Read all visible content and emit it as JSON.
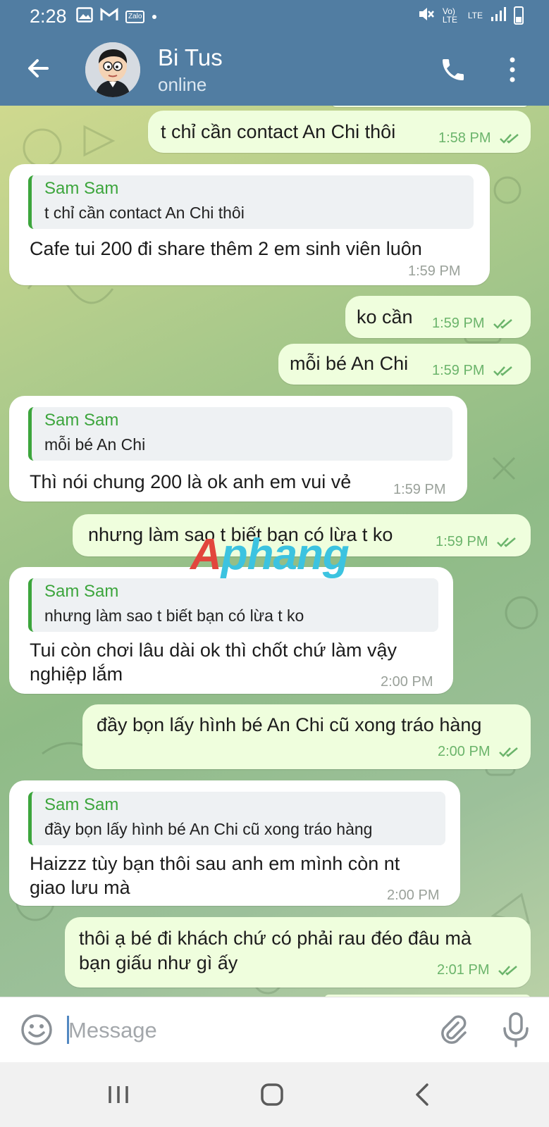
{
  "status_bar": {
    "time": "2:28",
    "left_icons": [
      "image-icon",
      "gmail-icon",
      "zalo-icon",
      "dot-icon"
    ],
    "zalo_label": "Zalo",
    "right_icons": [
      "mute-icon",
      "volte-icon",
      "lte-icon",
      "signal-icon",
      "battery-icon"
    ],
    "volte_label": "Vo) LTE",
    "lte_label": "LTE"
  },
  "header": {
    "contact_name": "Bi Tus",
    "contact_status": "online",
    "icons": [
      "back-arrow-icon",
      "phone-icon",
      "more-vertical-icon"
    ]
  },
  "messages": [
    {
      "id": 1,
      "direction": "outgoing",
      "text": "t chỉ cần contact An Chi thôi",
      "time": "1:58 PM",
      "read": true
    },
    {
      "id": 2,
      "direction": "incoming",
      "reply_to": {
        "name": "Sam Sam",
        "text": "t chỉ cần contact An Chi thôi"
      },
      "lines": [
        "Cafe tui 200 đi share thêm 2 em sinh viên luôn"
      ],
      "time": "1:59 PM"
    },
    {
      "id": 3,
      "direction": "outgoing",
      "text": "ko cần",
      "time": "1:59 PM",
      "read": true
    },
    {
      "id": 4,
      "direction": "outgoing",
      "text": "mỗi bé An Chi",
      "time": "1:59 PM",
      "read": true
    },
    {
      "id": 5,
      "direction": "incoming",
      "reply_to": {
        "name": "Sam Sam",
        "text": "mỗi bé An Chi"
      },
      "lines": [
        "Thì nói chung 200 là ok anh em vui vẻ"
      ],
      "time": "1:59 PM"
    },
    {
      "id": 6,
      "direction": "outgoing",
      "text": "nhưng làm sao t biết bạn có lừa t ko",
      "time": "1:59 PM",
      "read": true
    },
    {
      "id": 7,
      "direction": "incoming",
      "reply_to": {
        "name": "Sam Sam",
        "text": "nhưng làm sao t biết bạn có lừa t ko"
      },
      "lines": [
        "Tui còn chơi lâu dài ok thì chốt chứ làm vậy",
        "nghiệp lắm"
      ],
      "time": "2:00 PM"
    },
    {
      "id": 8,
      "direction": "outgoing",
      "text": "đầy bọn lấy hình bé An Chi cũ xong tráo hàng",
      "time": "2:00 PM",
      "read": true
    },
    {
      "id": 9,
      "direction": "incoming",
      "reply_to": {
        "name": "Sam Sam",
        "text": "đầy bọn lấy hình bé An Chi cũ xong tráo hàng"
      },
      "lines": [
        "Haizzz tùy bạn thôi sau anh em mình còn nt",
        "giao lưu mà"
      ],
      "time": "2:00 PM"
    },
    {
      "id": 10,
      "direction": "outgoing",
      "lines": [
        "thôi ạ bé đi khách chứ có phải rau đéo đâu mà",
        "bạn giấu như gì ấy"
      ],
      "time": "2:01 PM",
      "read": true
    }
  ],
  "watermark": {
    "part1": "A",
    "part2": "phang"
  },
  "input_bar": {
    "placeholder": "Message",
    "icons": [
      "emoji-icon",
      "attach-paperclip-icon",
      "microphone-icon"
    ]
  },
  "nav_bar": {
    "icons": [
      "recent-apps-icon",
      "home-icon",
      "back-icon"
    ]
  },
  "colors": {
    "header": "#517da2",
    "outgoing_bubble": "#effedd",
    "incoming_bubble": "#ffffff",
    "reply_accent": "#3ca53c",
    "read_check": "#6bb46b"
  }
}
